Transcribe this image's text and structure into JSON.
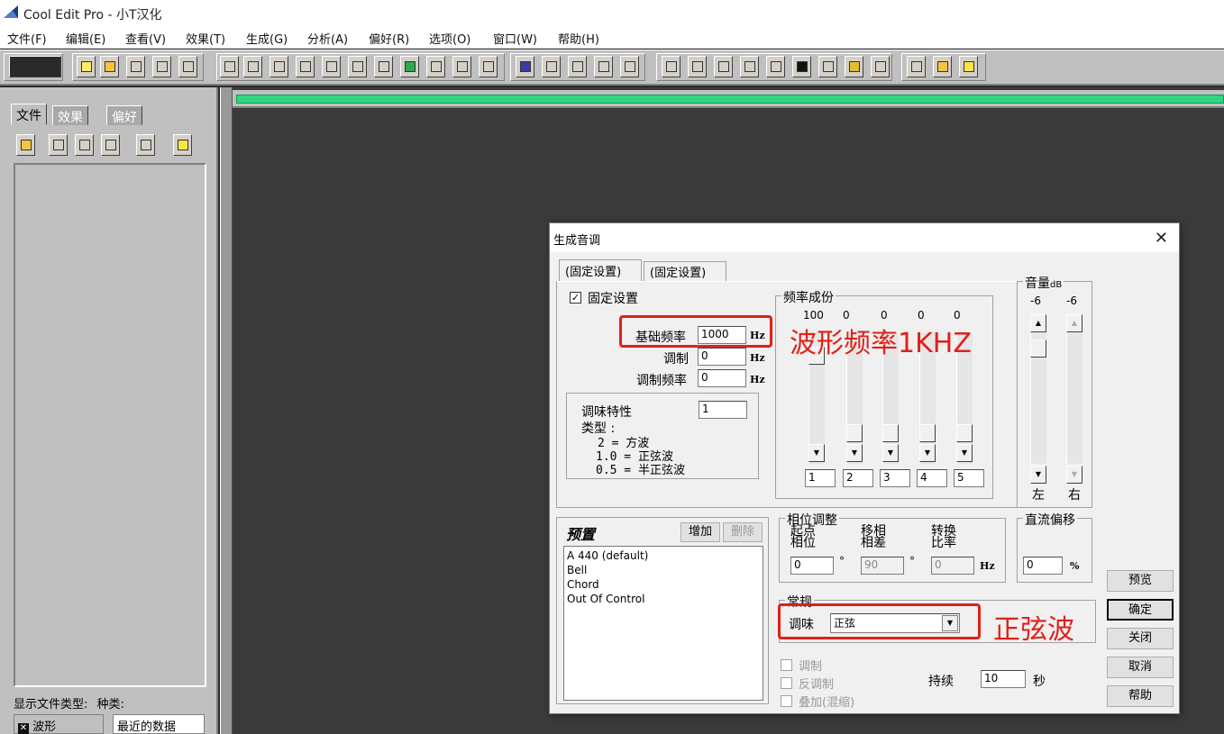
{
  "app": {
    "title": "Cool Edit Pro  - 小T汉化"
  },
  "menu": [
    "文件(F)",
    "编辑(E)",
    "查看(V)",
    "效果(T)",
    "生成(G)",
    "分析(A)",
    "偏好(R)",
    "选项(O)",
    "窗口(W)",
    "帮助(H)"
  ],
  "left_panel": {
    "tabs": [
      "文件",
      "效果",
      "偏好"
    ],
    "show_file_type_label": "显示文件类型:",
    "kind_label": "种类:",
    "file_type_value": "波形",
    "recent_value": "最近的数据"
  },
  "dialog": {
    "title": "生成音调",
    "close_glyph": "✕",
    "tabs": [
      "(固定设置)",
      "(固定设置)"
    ],
    "fixed_setting_label": "固定设置",
    "fixed_setting_checked": true,
    "base_freq_label": "基础频率",
    "base_freq_value": "1000",
    "modulation_label": "调制",
    "modulation_value": "0",
    "mod_freq_label": "调制频率",
    "mod_freq_value": "0",
    "hz": "Hz",
    "flavor_box": {
      "label": "调味特性",
      "value": "1",
      "type_label": "类型 :",
      "line1": "2 = 方波",
      "line2": "1.0 = 正弦波",
      "line3": "0.5 = 半正弦波"
    },
    "freq_components": {
      "legend": "频率成份",
      "levels": [
        "100",
        "0",
        "0",
        "0",
        "0"
      ],
      "inputs": [
        "1",
        "2",
        "3",
        "4",
        "5"
      ]
    },
    "volume": {
      "legend": "音量",
      "unit": "dB",
      "left_value": "-6",
      "right_value": "-6",
      "left_label": "左",
      "right_label": "右"
    },
    "preset": {
      "title": "预置",
      "add_label": "增加",
      "delete_label": "删除",
      "items": [
        "A 440 (default)",
        "Bell",
        "Chord",
        "Out Of Control"
      ]
    },
    "phase": {
      "legend": "相位调整",
      "start_label": "起点\n相位",
      "start_l1": "起点",
      "start_l2": "相位",
      "shift_l1": "移相",
      "shift_l2": "相差",
      "rate_l1": "转换",
      "rate_l2": "比率",
      "start_value": "0",
      "shift_value": "90",
      "rate_value": "0",
      "degree": "°"
    },
    "dc_offset": {
      "legend": "直流偏移",
      "value": "0",
      "unit": "%"
    },
    "general": {
      "legend": "常规",
      "flavor_label": "调味",
      "flavor_value": "正弦"
    },
    "options": {
      "modulate": "调制",
      "demodulate": "反调制",
      "overlay": "叠加(混缩)"
    },
    "duration": {
      "label": "持续",
      "value": "10",
      "unit": "秒"
    },
    "buttons": {
      "preview": "预览",
      "ok": "确定",
      "close": "关闭",
      "cancel": "取消",
      "help": "帮助"
    }
  },
  "annotations": {
    "freq_note": "波形频率1KHZ",
    "sine_note": "正弦波",
    "color": "#e0201a"
  }
}
